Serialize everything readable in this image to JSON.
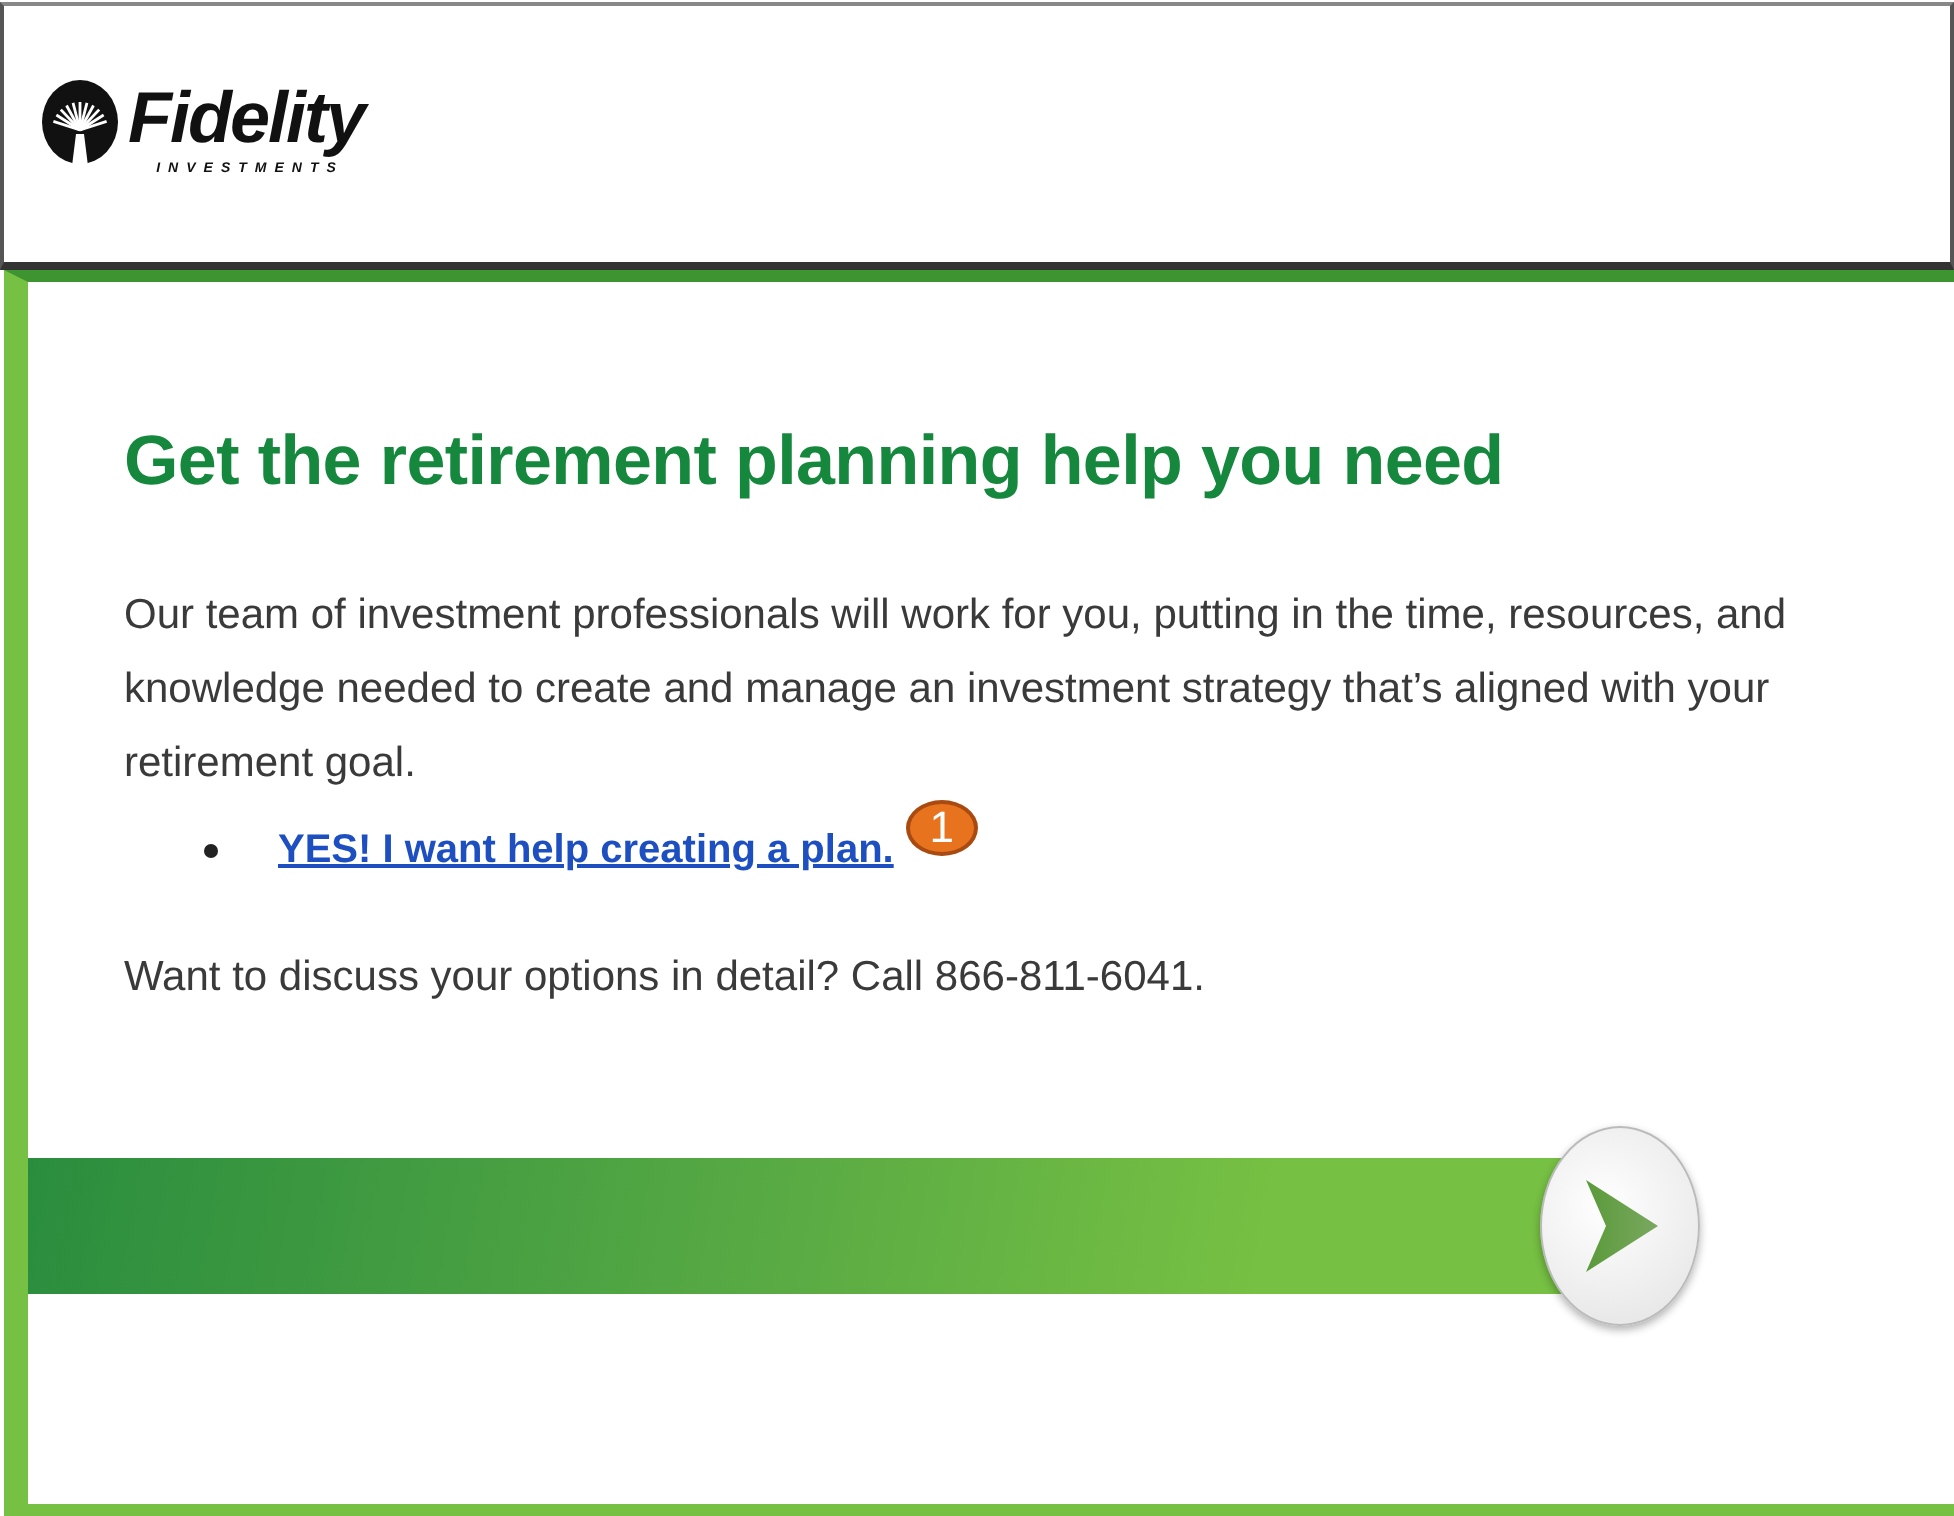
{
  "header": {
    "logo_name": "Fidelity",
    "logo_tagline": "INVESTMENTS"
  },
  "content": {
    "title": "Get the retirement planning help you need",
    "intro": "Our team of investment professionals will work for you, putting in the time, resources, and knowledge needed to create and manage an investment strategy that’s aligned with your retirement goal.",
    "links": [
      {
        "label": "YES! I want help creating a plan.",
        "callout": "1"
      }
    ],
    "contact": "Want to discuss your options in detail? Call 866-811-6041."
  }
}
